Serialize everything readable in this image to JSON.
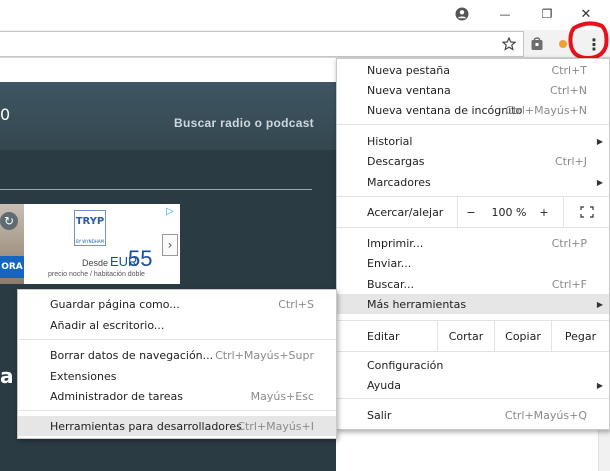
{
  "window": {
    "profile_icon": "account-circle-icon",
    "minimize_glyph": "—",
    "maximize_glyph": "❐",
    "close_glyph": "✕"
  },
  "toolbar": {
    "bookmark_icon": "star-icon",
    "extension_icons": [
      "bag-extension-icon",
      "orange-extension-icon"
    ],
    "menu_icon": "vertical-dots-icon",
    "menu_glyph": "⋮",
    "highlight_color": "#e8101a"
  },
  "page": {
    "header_number": "0",
    "search_link": "Buscar radio o podcast",
    "side_letter": "a",
    "ad": {
      "logo": "TRYP",
      "logo_sub": "BY WYNDHAM",
      "cta": "ORA",
      "price_prefix": "Desde",
      "currency": "EUR",
      "price": "55",
      "price_note": "precio noche / habitación doble"
    }
  },
  "main_menu": {
    "new_tab": {
      "label": "Nueva pestaña",
      "shortcut": "Ctrl+T"
    },
    "new_window": {
      "label": "Nueva ventana",
      "shortcut": "Ctrl+N"
    },
    "incognito": {
      "label": "Nueva ventana de incógnito",
      "shortcut": "Ctrl+Mayús+N"
    },
    "history": {
      "label": "Historial"
    },
    "downloads": {
      "label": "Descargas",
      "shortcut": "Ctrl+J"
    },
    "bookmarks": {
      "label": "Marcadores"
    },
    "zoom": {
      "label": "Acercar/alejar",
      "minus": "−",
      "value": "100 %",
      "plus": "+",
      "fullscreen_glyph": "⛶"
    },
    "print": {
      "label": "Imprimir...",
      "shortcut": "Ctrl+P"
    },
    "send": {
      "label": "Enviar..."
    },
    "find": {
      "label": "Buscar...",
      "shortcut": "Ctrl+F"
    },
    "more_tools": {
      "label": "Más herramientas"
    },
    "edit": {
      "label": "Editar",
      "cut": "Cortar",
      "copy": "Copiar",
      "paste": "Pegar"
    },
    "settings": {
      "label": "Configuración"
    },
    "help": {
      "label": "Ayuda"
    },
    "exit": {
      "label": "Salir",
      "shortcut": "Ctrl+Mayús+Q"
    },
    "arrow_glyph": "▶"
  },
  "submenu": {
    "save_page": {
      "label": "Guardar página como...",
      "shortcut": "Ctrl+S"
    },
    "add_to_desktop": {
      "label": "Añadir al escritorio..."
    },
    "clear_data": {
      "label": "Borrar datos de navegación...",
      "shortcut": "Ctrl+Mayús+Supr"
    },
    "extensions": {
      "label": "Extensiones"
    },
    "task_manager": {
      "label": "Administrador de tareas",
      "shortcut": "Mayús+Esc"
    },
    "dev_tools": {
      "label": "Herramientas para desarrolladores",
      "shortcut": "Ctrl+Mayús+I"
    }
  }
}
